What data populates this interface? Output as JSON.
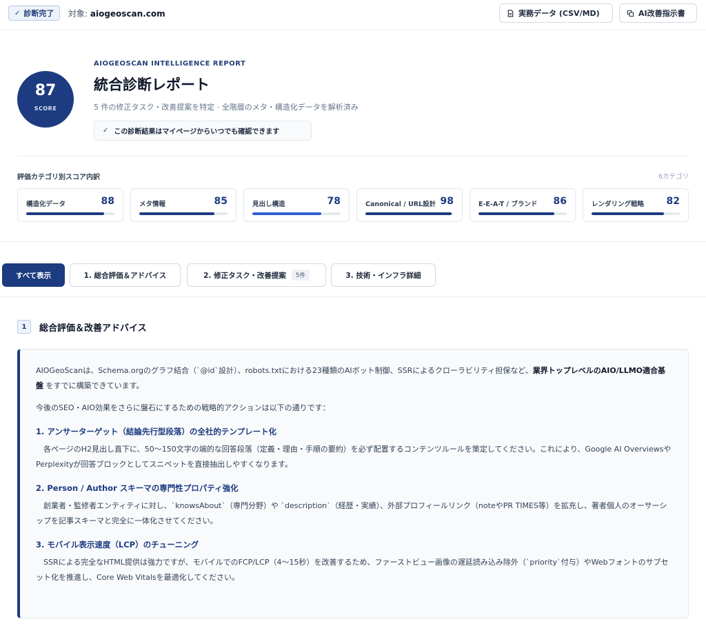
{
  "topbar": {
    "status_badge": "診断完了",
    "target_label": "対象:",
    "target_domain": "aiogeoscan.com",
    "csv_button": "実務データ (CSV/MD)",
    "ai_button": "AI改善指示書"
  },
  "hero": {
    "score": "87",
    "score_label": "SCORE",
    "eyebrow": "AIOGEOSCAN INTELLIGENCE REPORT",
    "title": "統合診断レポート",
    "subtitle": "5 件の修正タスク・改善提案を特定 · 全階層のメタ・構造化データを解析済み",
    "saved_note": "この診断結果はマイページからいつでも確認できます"
  },
  "categories": {
    "title": "評価カテゴリ別スコア内訳",
    "count": "6カテゴリ",
    "items": [
      {
        "name": "構造化データ",
        "score": "88",
        "value": 88
      },
      {
        "name": "メタ情報",
        "score": "85",
        "value": 85
      },
      {
        "name": "見出し構造",
        "score": "78",
        "value": 78
      },
      {
        "name": "Canonical / URL設計",
        "score": "98",
        "value": 98
      },
      {
        "name": "E-E-A-T / ブランド",
        "score": "86",
        "value": 86
      },
      {
        "name": "レンダリング戦略",
        "score": "82",
        "value": 82
      }
    ]
  },
  "tabs": [
    {
      "label": "すべて表示"
    },
    {
      "label": "1. 総合評価＆アドバイス"
    },
    {
      "label": "2. 修正タスク・改善提案",
      "badge": "5件"
    },
    {
      "label": "3. 技術・インフラ詳細"
    }
  ],
  "section1": {
    "number": "1",
    "title": "総合評価＆改善アドバイス",
    "intro_pre": "AIOGeoScanは、Schema.orgのグラフ結合（`@id`設計）、robots.txtにおける23種類のAIボット制御、SSRによるクローラビリティ担保など、",
    "intro_bold": "業界トップレベルのAIO/LLMO適合基盤",
    "intro_post": " をすでに構築できています。",
    "lead": "今後のSEO・AIO効果をさらに盤石にするための戦略的アクションは以下の通りです：",
    "items": [
      {
        "heading": "1. アンサーターゲット（結論先行型段落）の全社的テンプレート化",
        "body": "各ページのH2見出し直下に、50〜150文字の端的な回答段落（定義・理由・手順の要約）を必ず配置するコンテンツルールを策定してください。これにより、Google AI OverviewsやPerplexityが回答ブロックとしてスニペットを直接抽出しやすくなります。"
      },
      {
        "heading": "2. Person / Author スキーマの専門性プロパティ強化",
        "body": "創業者・監修者エンティティに対し、`knowsAbout`（専門分野）や `description`（経歴・実績）、外部プロフィールリンク（noteやPR TIMES等）を拡充し、著者個人のオーサーシップを記事スキーマと完全に一体化させてください。"
      },
      {
        "heading": "3. モバイル表示速度（LCP）のチューニング",
        "body": "SSRによる完全なHTML提供は強力ですが、モバイルでのFCP/LCP（4〜15秒）を改善するため、ファーストビュー画像の遅延読み込み除外（`priority`付与）やWebフォントのサブセット化を推進し、Core Web Vitalsを最適化してください。"
      }
    ]
  }
}
